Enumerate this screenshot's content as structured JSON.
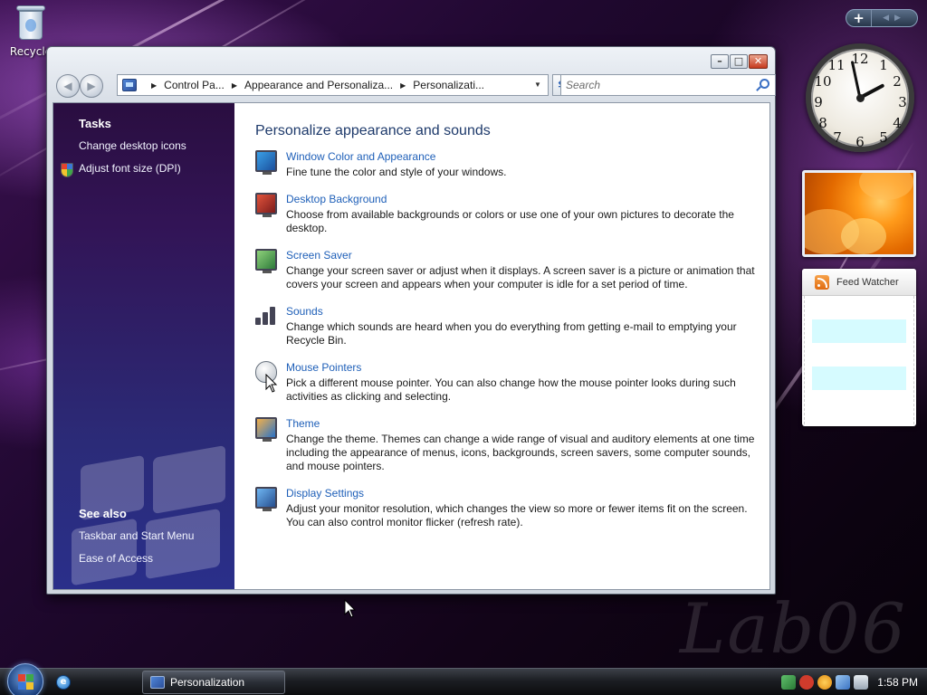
{
  "desktop": {
    "recycle_bin_label": "Recycle",
    "watermark": "Lab06"
  },
  "window": {
    "breadcrumb": [
      "Control Pa...",
      "Appearance and Personaliza...",
      "Personalizati..."
    ],
    "search_placeholder": "Search"
  },
  "sidebar": {
    "tasks_heading": "Tasks",
    "tasks": [
      {
        "label": "Change desktop icons",
        "icon": null
      },
      {
        "label": "Adjust font size (DPI)",
        "icon": "uac-shield-icon"
      }
    ],
    "see_also_heading": "See also",
    "see_also": [
      {
        "label": "Taskbar and Start Menu"
      },
      {
        "label": "Ease of Access"
      }
    ]
  },
  "main": {
    "heading": "Personalize appearance and sounds",
    "items": [
      {
        "title": "Window Color and Appearance",
        "desc": "Fine tune the color and style of your windows.",
        "icon": "window-color-icon"
      },
      {
        "title": "Desktop Background",
        "desc": "Choose from available backgrounds or colors or use one of your own pictures to decorate the desktop.",
        "icon": "desktop-background-icon"
      },
      {
        "title": "Screen Saver",
        "desc": "Change your screen saver or adjust when it displays. A screen saver is a picture or animation that covers your screen and appears when your computer is idle for a set period of time.",
        "icon": "screen-saver-icon"
      },
      {
        "title": "Sounds",
        "desc": "Change which sounds are heard when you do everything from getting e-mail to emptying your Recycle Bin.",
        "icon": "sounds-icon"
      },
      {
        "title": "Mouse Pointers",
        "desc": "Pick a different mouse pointer. You can also change how the mouse pointer looks during such activities as clicking and selecting.",
        "icon": "mouse-pointer-icon"
      },
      {
        "title": "Theme",
        "desc": "Change the theme. Themes can change a wide range of visual and auditory elements at one time including the appearance of menus, icons, backgrounds, screen savers, some computer sounds, and mouse pointers.",
        "icon": "theme-icon"
      },
      {
        "title": "Display Settings",
        "desc": "Adjust your monitor resolution, which changes the view so more or fewer items fit on the screen. You can also control monitor flicker (refresh rate).",
        "icon": "display-settings-icon"
      }
    ]
  },
  "gadgets": {
    "clock_numbers": [
      "12",
      "1",
      "2",
      "3",
      "4",
      "5",
      "6",
      "7",
      "8",
      "9",
      "10",
      "11"
    ],
    "feed_title": "Feed Watcher"
  },
  "taskbar": {
    "task_label": "Personalization",
    "time": "1:58 PM"
  },
  "colors": {
    "link": "#1e5fb8",
    "heading": "#1e3a6b",
    "nav_bg": "#2b2b78"
  }
}
